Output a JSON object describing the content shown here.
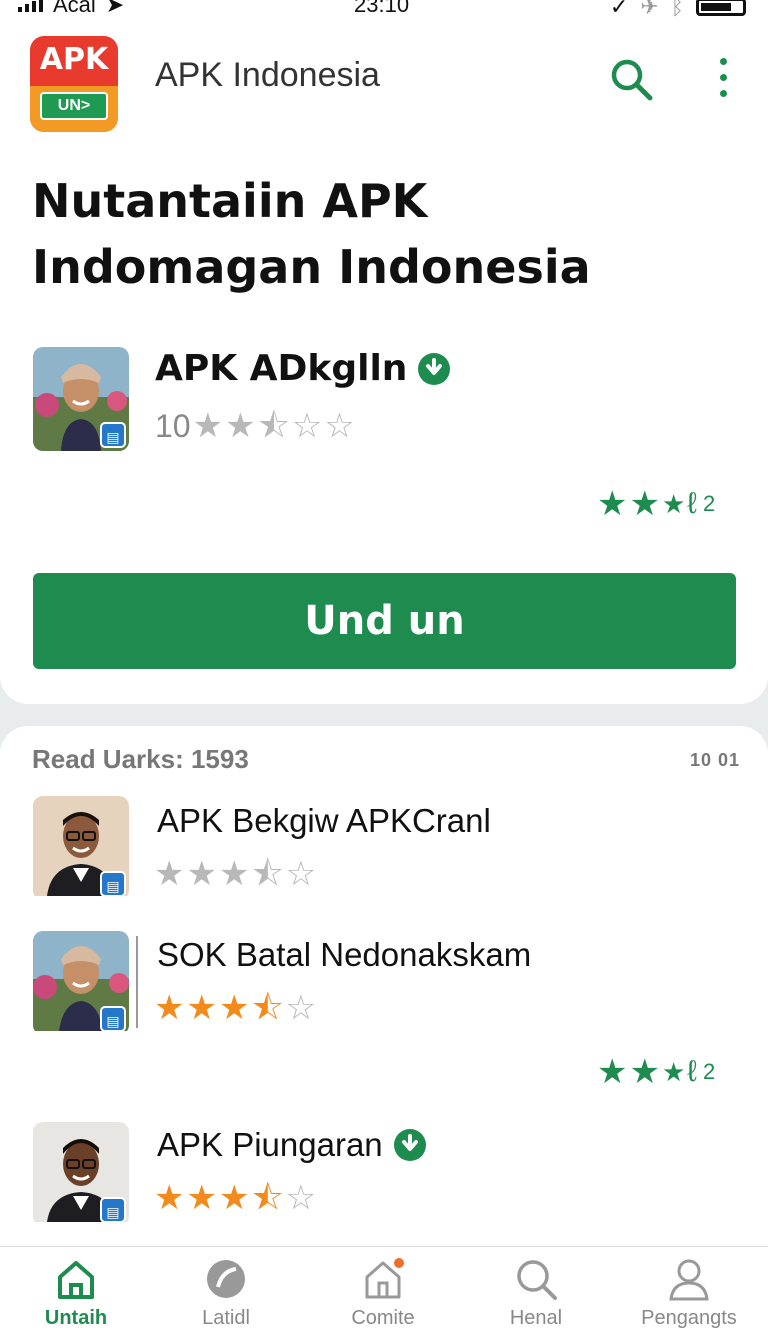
{
  "status_bar": {
    "carrier": "Acal",
    "time": "23:10"
  },
  "header": {
    "logo_text": "APK",
    "logo_button_text": "UN>",
    "app_name": "APK Indonesia"
  },
  "hero": {
    "title": "Nutantaiin APK Indomagan Indonesia"
  },
  "featured": {
    "title": "APK ADkglln",
    "rating_count": "10",
    "rating_stars": 2.5,
    "green_badge_number": "2",
    "install_label": "Und un"
  },
  "list": {
    "header": "Read Uarks: 1593",
    "header_right": "10 01",
    "items": [
      {
        "title": "APK Bekgiw APKCranl",
        "stars": 3.5,
        "star_color": "#b8b8b8"
      },
      {
        "title": "SOK Batal Nedonakskam",
        "stars": 3.5,
        "star_color": "#f28a1c",
        "green_badge_number": "2"
      },
      {
        "title": "APK Piungaran",
        "stars": 3.5,
        "star_color": "#f28a1c"
      }
    ]
  },
  "bottom_nav": {
    "items": [
      {
        "label": "Untaih",
        "icon": "home-icon",
        "active": true
      },
      {
        "label": "Latidl",
        "icon": "disc-icon",
        "active": false
      },
      {
        "label": "Comite",
        "icon": "house-notify-icon",
        "active": false
      },
      {
        "label": "Henal",
        "icon": "search-icon",
        "active": false
      },
      {
        "label": "Pengangts",
        "icon": "person-icon",
        "active": false
      }
    ]
  },
  "colors": {
    "accent_green": "#1e8c4e",
    "star_orange": "#f28a1c",
    "star_gray": "#b8b8b8"
  }
}
